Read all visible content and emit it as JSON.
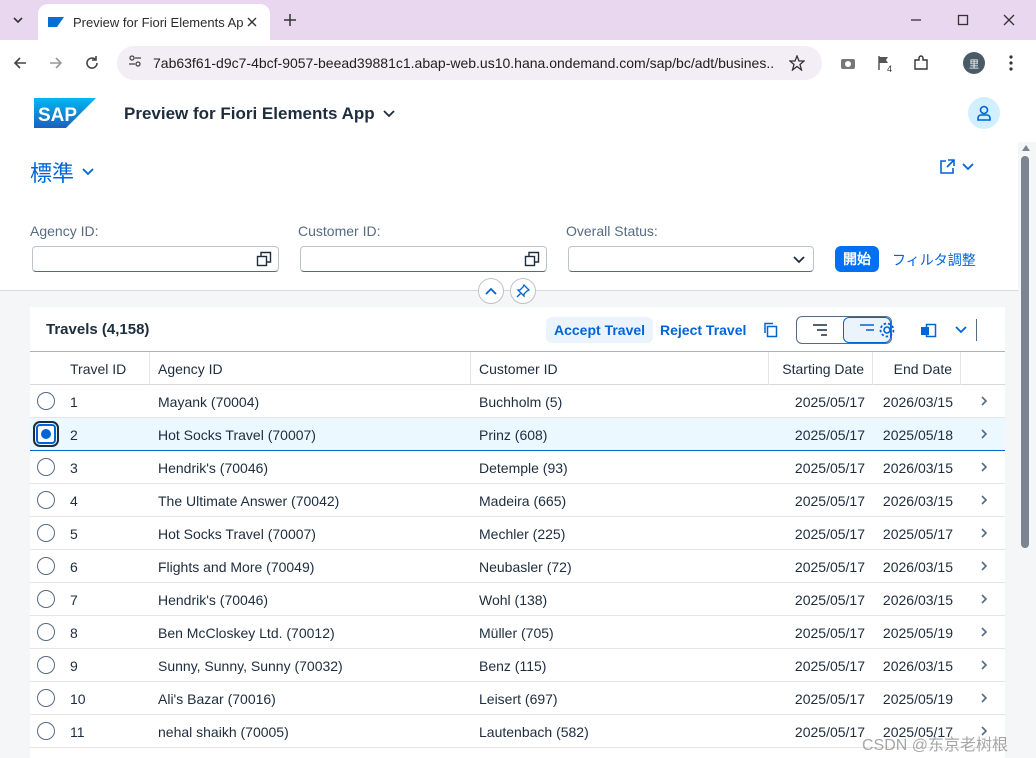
{
  "browser": {
    "tab_title": "Preview for Fiori Elements App",
    "url": "7ab63f61-d9c7-4bcf-9057-beead39881c1.abap-web.us10.hana.ondemand.com/sap/bc/adt/busines...",
    "extension_badge": "4",
    "profile_initial": "里"
  },
  "shell": {
    "logo_text": "SAP",
    "app_title": "Preview for Fiori Elements App"
  },
  "header": {
    "variant_name": "標準",
    "filters": [
      {
        "label": "Agency ID:",
        "value": ""
      },
      {
        "label": "Customer ID:",
        "value": ""
      },
      {
        "label": "Overall Status:",
        "value": ""
      }
    ],
    "go_label": "開始",
    "adapt_filters_label": "フィルタ調整"
  },
  "table": {
    "title": "Travels (4,158)",
    "accept_label": "Accept Travel",
    "reject_label": "Reject Travel",
    "columns": [
      "Travel ID",
      "Agency ID",
      "Customer ID",
      "Starting Date",
      "End Date"
    ],
    "rows": [
      {
        "id": "1",
        "agency": "Mayank (70004)",
        "customer": "Buchholm (5)",
        "start": "2025/05/17",
        "end": "2026/03/15",
        "selected": false
      },
      {
        "id": "2",
        "agency": "Hot Socks Travel (70007)",
        "customer": "Prinz (608)",
        "start": "2025/05/17",
        "end": "2025/05/18",
        "selected": true
      },
      {
        "id": "3",
        "agency": "Hendrik's (70046)",
        "customer": "Detemple (93)",
        "start": "2025/05/17",
        "end": "2026/03/15",
        "selected": false
      },
      {
        "id": "4",
        "agency": "The Ultimate Answer (70042)",
        "customer": "Madeira (665)",
        "start": "2025/05/17",
        "end": "2026/03/15",
        "selected": false
      },
      {
        "id": "5",
        "agency": "Hot Socks Travel (70007)",
        "customer": "Mechler (225)",
        "start": "2025/05/17",
        "end": "2025/05/17",
        "selected": false
      },
      {
        "id": "6",
        "agency": "Flights and More (70049)",
        "customer": "Neubasler (72)",
        "start": "2025/05/17",
        "end": "2026/03/15",
        "selected": false
      },
      {
        "id": "7",
        "agency": "Hendrik's (70046)",
        "customer": "Wohl (138)",
        "start": "2025/05/17",
        "end": "2026/03/15",
        "selected": false
      },
      {
        "id": "8",
        "agency": "Ben McCloskey Ltd. (70012)",
        "customer": "Müller (705)",
        "start": "2025/05/17",
        "end": "2025/05/19",
        "selected": false
      },
      {
        "id": "9",
        "agency": "Sunny, Sunny, Sunny (70032)",
        "customer": "Benz (115)",
        "start": "2025/05/17",
        "end": "2026/03/15",
        "selected": false
      },
      {
        "id": "10",
        "agency": "Ali's Bazar (70016)",
        "customer": "Leisert (697)",
        "start": "2025/05/17",
        "end": "2025/05/19",
        "selected": false
      },
      {
        "id": "11",
        "agency": "nehal shaikh (70005)",
        "customer": "Lautenbach (582)",
        "start": "2025/05/17",
        "end": "2025/05/17",
        "selected": false
      }
    ]
  },
  "watermark": "CSDN @东京老树根",
  "colors": {
    "brand_blue": "#0064d9",
    "emphasized": "#0070f2",
    "selection_bg": "#ebf8ff",
    "chrome_bg": "#e8d7ee"
  }
}
